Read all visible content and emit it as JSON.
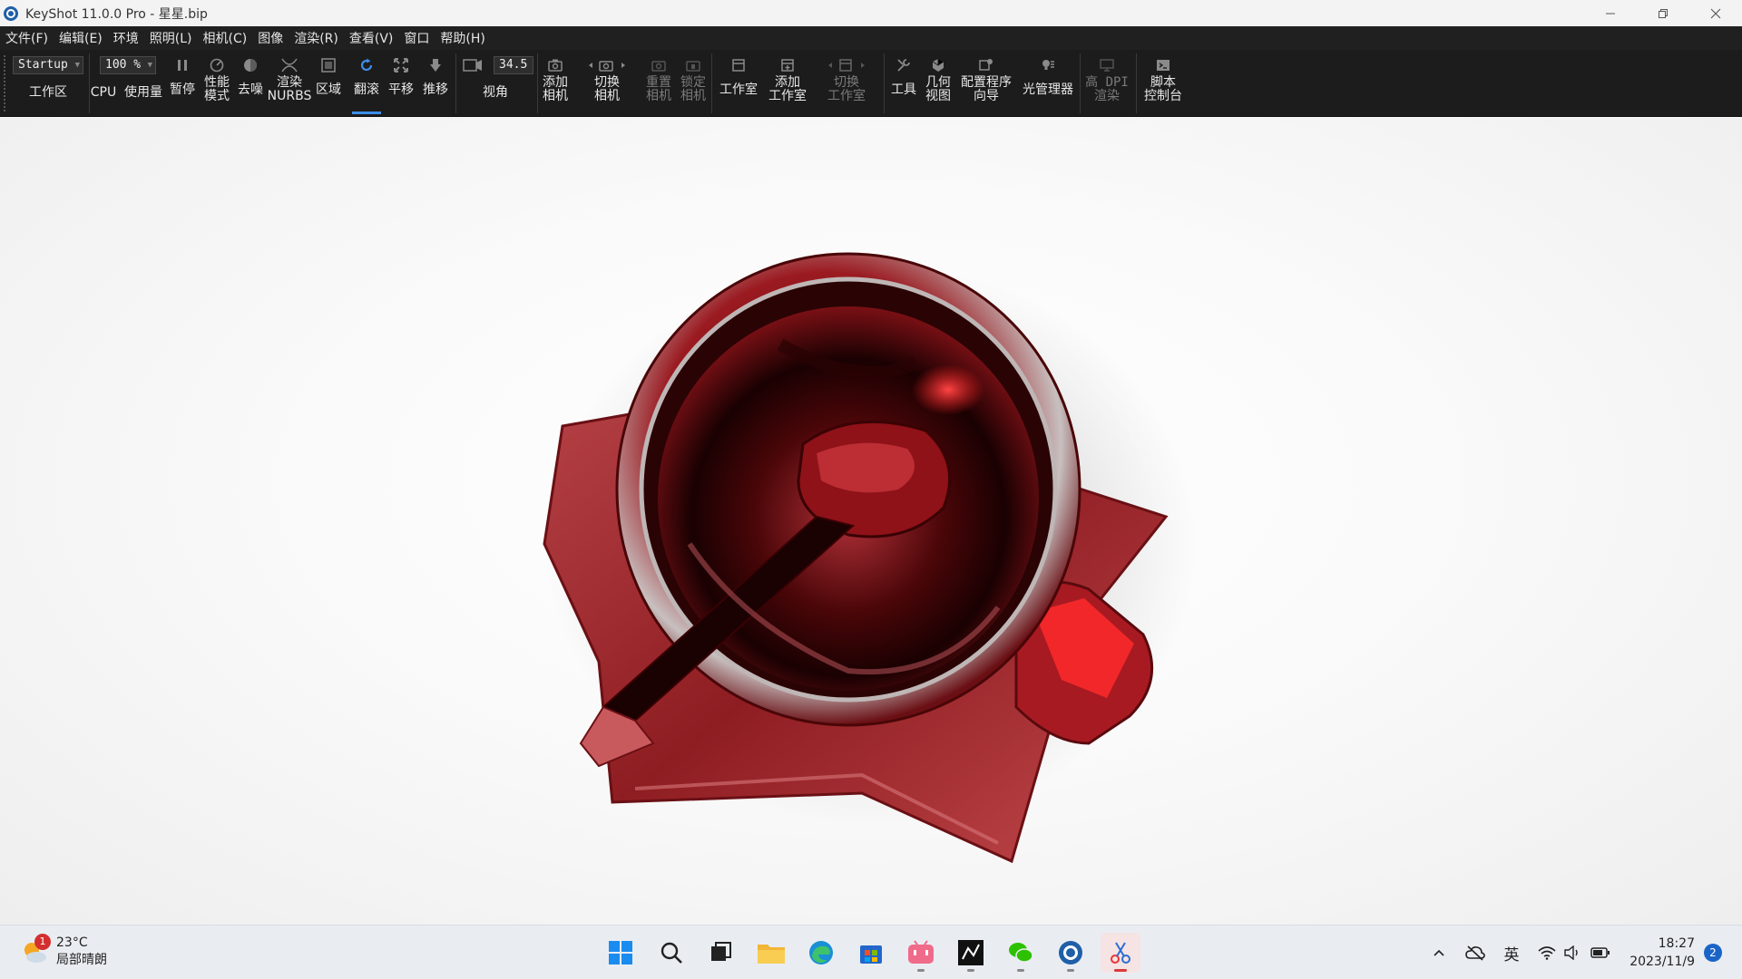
{
  "window": {
    "title": "KeyShot 11.0.0 Pro  - 星星.bip",
    "minimize_icon": "minimize-icon",
    "restore_icon": "restore-icon",
    "close_icon": "close-icon"
  },
  "menu": {
    "items": [
      "文件(F)",
      "编辑(E)",
      "环境",
      "照明(L)",
      "相机(C)",
      "图像",
      "渲染(R)",
      "查看(V)",
      "窗口",
      "帮助(H)"
    ]
  },
  "ribbon": {
    "workspace": {
      "value": "Startup",
      "label": "工作区"
    },
    "cpu": {
      "zoom_value": "100 %",
      "label_cpu": "CPU",
      "label_usage": "使用量"
    },
    "buttons": {
      "pause": "暂停",
      "perf_mode": "性能\n模式",
      "denoise": "去噪",
      "render_nurbs": "渲染\nNURBS",
      "region": "区域",
      "tumble": "翻滚",
      "pan": "平移",
      "dolly": "推移",
      "fov": "视角",
      "add_camera": "添加\n相机",
      "switch_camera": "切换\n相机",
      "reset_camera": "重置\n相机",
      "lock_camera": "锁定\n相机",
      "studio": "工作室",
      "add_studio": "添加\n工作室",
      "switch_studio": "切换\n工作室",
      "tools": "工具",
      "geometry_view": "几何\n视图",
      "configurator": "配置程序\n向导",
      "light_manager": "光管理器",
      "hidpi": "高 DPI\n渲染",
      "script_console": "脚本\n控制台"
    },
    "fov_value": "34.5"
  },
  "scene": {
    "object": "red chrome mug on star-shaped base with spoon",
    "accent": "#c0202a"
  },
  "taskbar": {
    "weather": {
      "temp": "23°C",
      "desc": "局部晴朗",
      "badge": "1"
    },
    "apps": [
      "windows-start-icon",
      "search-icon",
      "task-view-icon",
      "file-explorer-icon",
      "edge-icon",
      "store-icon",
      "bilibili-icon",
      "rhino-icon",
      "wechat-icon",
      "keyshot-icon",
      "snipping-tool-icon"
    ],
    "ime": "英",
    "time": "18:27",
    "date": "2023/11/9",
    "notifications": "2"
  }
}
